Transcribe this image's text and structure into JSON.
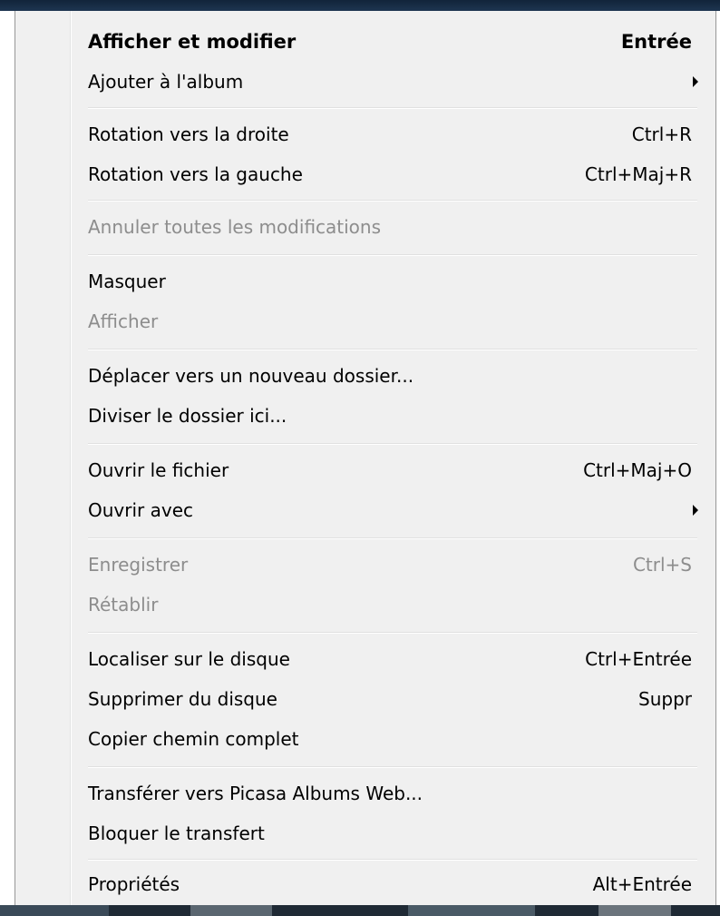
{
  "menu": {
    "items": [
      {
        "label": "Afficher et modifier",
        "shortcut": "Entrée"
      },
      {
        "label": "Ajouter à l'album",
        "shortcut": ""
      },
      {
        "label": "Rotation vers la droite",
        "shortcut": "Ctrl+R"
      },
      {
        "label": "Rotation vers la gauche",
        "shortcut": "Ctrl+Maj+R"
      },
      {
        "label": "Annuler toutes les modifications",
        "shortcut": ""
      },
      {
        "label": "Masquer",
        "shortcut": ""
      },
      {
        "label": "Afficher",
        "shortcut": ""
      },
      {
        "label": "Déplacer vers un nouveau dossier...",
        "shortcut": ""
      },
      {
        "label": "Diviser le dossier ici...",
        "shortcut": ""
      },
      {
        "label": "Ouvrir le fichier",
        "shortcut": "Ctrl+Maj+O"
      },
      {
        "label": "Ouvrir avec",
        "shortcut": ""
      },
      {
        "label": "Enregistrer",
        "shortcut": "Ctrl+S"
      },
      {
        "label": "Rétablir",
        "shortcut": ""
      },
      {
        "label": "Localiser sur le disque",
        "shortcut": "Ctrl+Entrée"
      },
      {
        "label": "Supprimer du disque",
        "shortcut": "Suppr"
      },
      {
        "label": "Copier chemin complet",
        "shortcut": ""
      },
      {
        "label": "Transférer vers Picasa Albums Web...",
        "shortcut": ""
      },
      {
        "label": "Bloquer le transfert",
        "shortcut": ""
      },
      {
        "label": "Propriétés",
        "shortcut": "Alt+Entrée"
      }
    ]
  }
}
